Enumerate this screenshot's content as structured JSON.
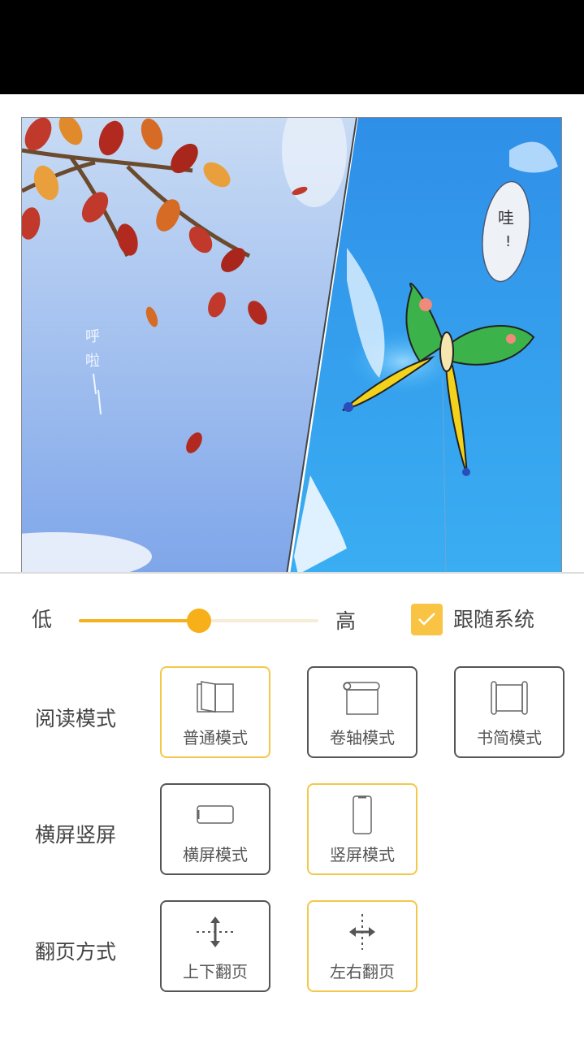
{
  "comic": {
    "left_panel_sfx": "呼啦——",
    "right_panel_speech": "哇！"
  },
  "brightness": {
    "low_label": "低",
    "high_label": "高",
    "value_percent": 50,
    "follow_system_label": "跟随系统",
    "follow_system_checked": true
  },
  "sections": [
    {
      "label": "阅读模式",
      "options": [
        {
          "label": "普通模式",
          "icon": "book-open-icon",
          "selected": true
        },
        {
          "label": "卷轴模式",
          "icon": "scroll-icon",
          "selected": false
        },
        {
          "label": "书简模式",
          "icon": "bamboo-slip-icon",
          "selected": false
        }
      ]
    },
    {
      "label": "横屏竖屏",
      "options": [
        {
          "label": "横屏模式",
          "icon": "phone-landscape-icon",
          "selected": false
        },
        {
          "label": "竖屏模式",
          "icon": "phone-portrait-icon",
          "selected": true
        }
      ]
    },
    {
      "label": "翻页方式",
      "options": [
        {
          "label": "上下翻页",
          "icon": "vertical-arrows-icon",
          "selected": false
        },
        {
          "label": "左右翻页",
          "icon": "horizontal-arrows-icon",
          "selected": true
        }
      ]
    }
  ],
  "colors": {
    "accent": "#f5b21d",
    "selected_border": "#f2c84b",
    "unselected_border": "#555555"
  }
}
